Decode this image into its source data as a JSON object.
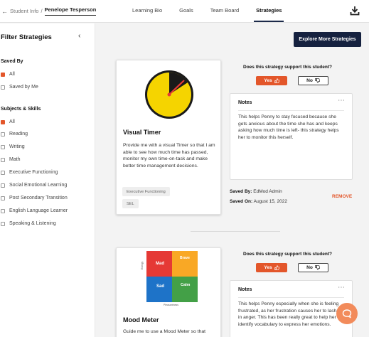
{
  "breadcrumb": {
    "back_icon": "arrow-left-icon",
    "parent": "Student Info",
    "separator": "/",
    "current": "Penelope Tesperson"
  },
  "nav": {
    "tabs": [
      "Learning Bio",
      "Goals",
      "Team Board",
      "Strategies"
    ],
    "active": "Strategies",
    "download_icon": "download-icon"
  },
  "sidebar": {
    "title": "Filter Strategies",
    "saved_by": {
      "heading": "Saved By",
      "options": [
        {
          "label": "All",
          "checked": true
        },
        {
          "label": "Saved by Me",
          "checked": false
        }
      ]
    },
    "subjects": {
      "heading": "Subjects & Skills",
      "options": [
        {
          "label": "All",
          "checked": true
        },
        {
          "label": "Reading",
          "checked": false
        },
        {
          "label": "Writing",
          "checked": false
        },
        {
          "label": "Math",
          "checked": false
        },
        {
          "label": "Executive Functioning",
          "checked": false
        },
        {
          "label": "Social Emotional Learning",
          "checked": false
        },
        {
          "label": "Post Secondary Transition",
          "checked": false
        },
        {
          "label": "English Language Learner",
          "checked": false
        },
        {
          "label": "Speaking & Listening",
          "checked": false
        }
      ]
    }
  },
  "explore_button": "Explore More Strategies",
  "strategies": [
    {
      "title": "Visual Timer",
      "description": "Provide me with a visual Timer so that I am able to see how much time has passed, monitor my own time-on-task and make better time management decisions.",
      "tags": [
        "Executive Functioning",
        "SEL"
      ],
      "question": "Does this strategy support this student?",
      "yes_label": "Yes",
      "no_label": "No",
      "notes_heading": "Notes",
      "notes_text": "This helps Penny to stay focused because she gets anxious about the time she has and keeps asking how much time is left- this strategy helps her to monitor this herself.",
      "saved_by_label": "Saved By:",
      "saved_by": "EdMod Admin",
      "saved_on_label": "Saved On:",
      "saved_on": "August 15, 2022",
      "remove_label": "REMOVE"
    },
    {
      "title": "Mood Meter",
      "description": "Guide me to use a Mood Meter so that",
      "question": "Does this strategy support this student?",
      "yes_label": "Yes",
      "no_label": "No",
      "notes_heading": "Notes",
      "notes_text": "This helps Penny especially when she is feeling frustrated, as her frustration causes her to lash out in anger. This has been really great to help her identify vocabulary to express her emotions.",
      "mood_labels": [
        "Mad",
        "Brave",
        "Sad",
        "Calm"
      ],
      "mood_axis_x": "Pleasantness",
      "mood_axis_y": "Energy"
    }
  ],
  "colors": {
    "accent": "#e3562a",
    "navy": "#15213f",
    "timer_yellow": "#f5d400",
    "mood_red": "#e53935",
    "mood_yellow": "#f9a825",
    "mood_blue": "#1e73c8",
    "mood_green": "#43a047"
  },
  "chat_icon": "chat-bubble-icon"
}
